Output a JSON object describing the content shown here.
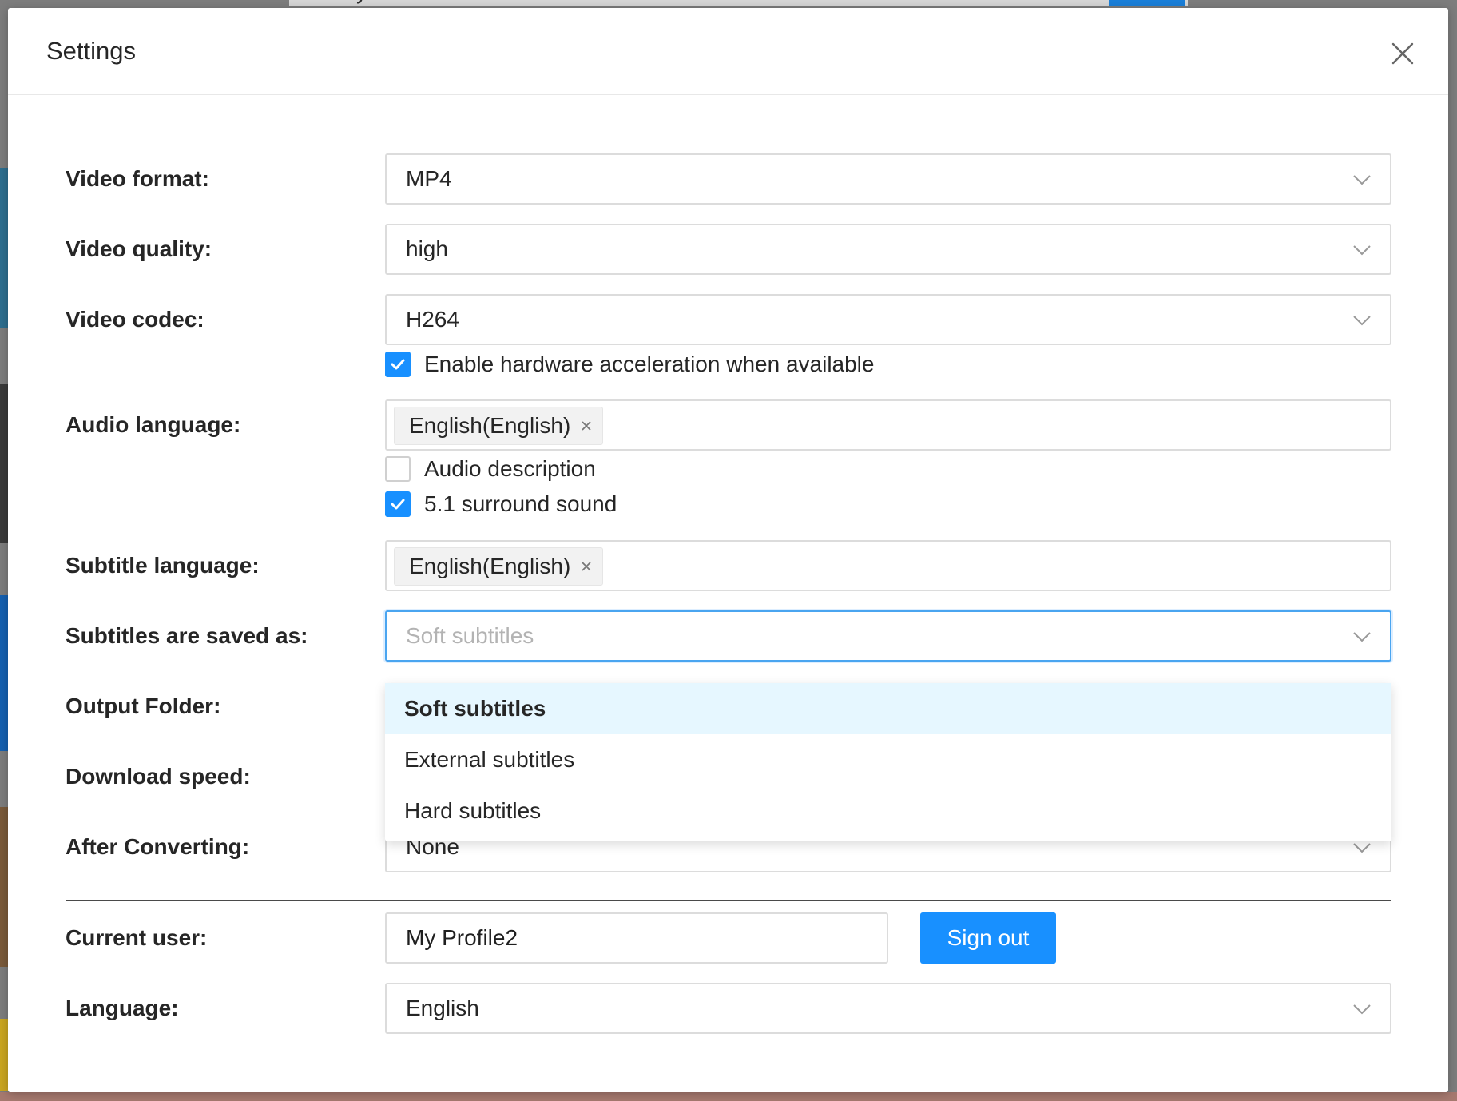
{
  "background": {
    "search_text": "disney"
  },
  "modal": {
    "title": "Settings",
    "close_icon": "close-icon"
  },
  "fields": {
    "video_format": {
      "label": "Video format:",
      "value": "MP4"
    },
    "video_quality": {
      "label": "Video quality:",
      "value": "high"
    },
    "video_codec": {
      "label": "Video codec:",
      "value": "H264"
    },
    "hw_accel": {
      "label": "Enable hardware acceleration when available",
      "checked": true
    },
    "audio_language": {
      "label": "Audio language:",
      "tag": "English(English)"
    },
    "audio_description": {
      "label": "Audio description",
      "checked": false
    },
    "surround": {
      "label": "5.1 surround sound",
      "checked": true
    },
    "subtitle_language": {
      "label": "Subtitle language:",
      "tag": "English(English)"
    },
    "subtitles_saved_as": {
      "label": "Subtitles are saved as:",
      "placeholder": "Soft subtitles"
    },
    "output_folder": {
      "label": "Output Folder:"
    },
    "download_speed": {
      "label": "Download speed:"
    },
    "after_converting": {
      "label": "After Converting:",
      "value": "None"
    },
    "current_user": {
      "label": "Current user:",
      "value": "My Profile2",
      "button": "Sign out"
    },
    "language": {
      "label": "Language:",
      "value": "English"
    }
  },
  "subtitle_dropdown": {
    "options": [
      "Soft subtitles",
      "External subtitles",
      "Hard subtitles"
    ],
    "selected": "Soft subtitles"
  },
  "colors": {
    "accent": "#1890ff",
    "selected_option_bg": "#e6f7ff"
  }
}
